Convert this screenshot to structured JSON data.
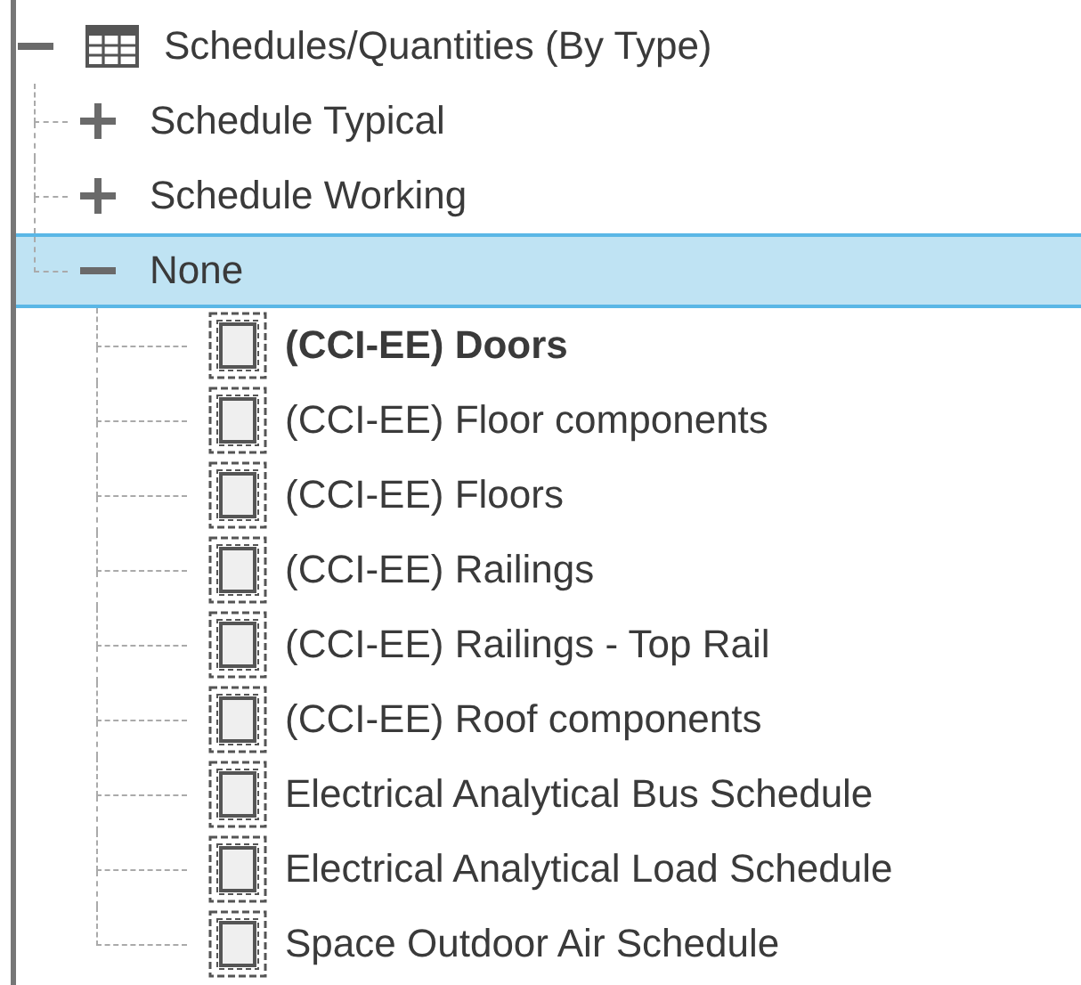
{
  "tree": {
    "kind": "category",
    "label": "Schedules/Quantities (By Type)",
    "expanded": true,
    "selected": false,
    "children": [
      {
        "kind": "group",
        "label": "Schedule Typical",
        "expanded": false,
        "selected": false
      },
      {
        "kind": "group",
        "label": "Schedule Working",
        "expanded": false,
        "selected": false
      },
      {
        "kind": "group",
        "label": "None",
        "expanded": true,
        "selected": true,
        "children": [
          {
            "kind": "schedule",
            "label": "(CCI-EE) Doors",
            "current": true,
            "selected": false
          },
          {
            "kind": "schedule",
            "label": "(CCI-EE) Floor components",
            "current": false,
            "selected": false
          },
          {
            "kind": "schedule",
            "label": "(CCI-EE) Floors",
            "current": false,
            "selected": false
          },
          {
            "kind": "schedule",
            "label": "(CCI-EE) Railings",
            "current": false,
            "selected": false
          },
          {
            "kind": "schedule",
            "label": "(CCI-EE) Railings - Top Rail",
            "current": false,
            "selected": false
          },
          {
            "kind": "schedule",
            "label": "(CCI-EE) Roof components",
            "current": false,
            "selected": false
          },
          {
            "kind": "schedule",
            "label": "Electrical Analytical Bus Schedule",
            "current": false,
            "selected": false
          },
          {
            "kind": "schedule",
            "label": "Electrical Analytical Load Schedule",
            "current": false,
            "selected": false
          },
          {
            "kind": "schedule",
            "label": "Space Outdoor Air Schedule",
            "current": false,
            "selected": false
          }
        ]
      }
    ]
  }
}
